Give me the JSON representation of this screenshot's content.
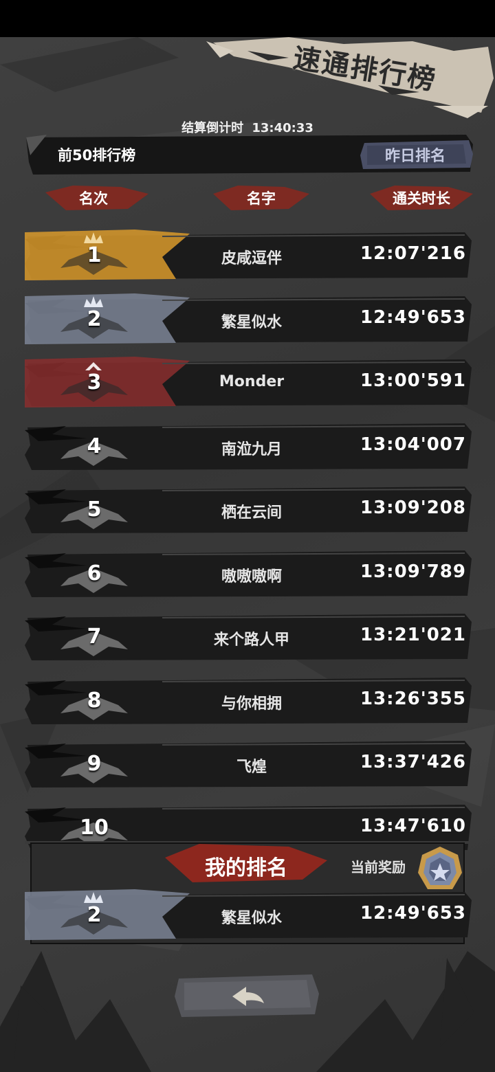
{
  "title": "速通排行榜",
  "countdown": {
    "label": "结算倒计时",
    "value": "13:40:33"
  },
  "top_label": "前50排行榜",
  "yesterday_button": "昨日排名",
  "headers": {
    "rank": "名次",
    "name": "名字",
    "time": "通关时长"
  },
  "rows": [
    {
      "rank": "1",
      "name": "皮咸逗伴",
      "time": "12:07'216"
    },
    {
      "rank": "2",
      "name": "繁星似水",
      "time": "12:49'653"
    },
    {
      "rank": "3",
      "name": "Monder",
      "time": "13:00'591"
    },
    {
      "rank": "4",
      "name": "南涖九月",
      "time": "13:04'007"
    },
    {
      "rank": "5",
      "name": "栖在云间",
      "time": "13:09'208"
    },
    {
      "rank": "6",
      "name": "嗷嗷嗷啊",
      "time": "13:09'789"
    },
    {
      "rank": "7",
      "name": "来个路人甲",
      "time": "13:21'021"
    },
    {
      "rank": "8",
      "name": "与你相拥",
      "time": "13:26'355"
    },
    {
      "rank": "9",
      "name": "飞煌",
      "time": "13:37'426"
    },
    {
      "rank": "10",
      "name": "",
      "time": "13:47'610"
    }
  ],
  "my_rank": {
    "title": "我的排名",
    "reward_label": "当前奖励",
    "rank": "2",
    "name": "繁星似水",
    "time": "12:49'653"
  },
  "icons": {
    "gold_badge": "gold-crown-badge-icon",
    "silver_badge": "silver-crown-badge-icon",
    "bronze_badge": "bronze-badge-icon",
    "rank_badge": "rank-ribbon-icon",
    "reward": "reward-medal-icon",
    "back": "back-arrow-icon"
  },
  "colors": {
    "gold": "#d99a2b",
    "silver": "#7d8597",
    "bronze": "#8a2e2e",
    "accent_red": "#9b2b23"
  }
}
